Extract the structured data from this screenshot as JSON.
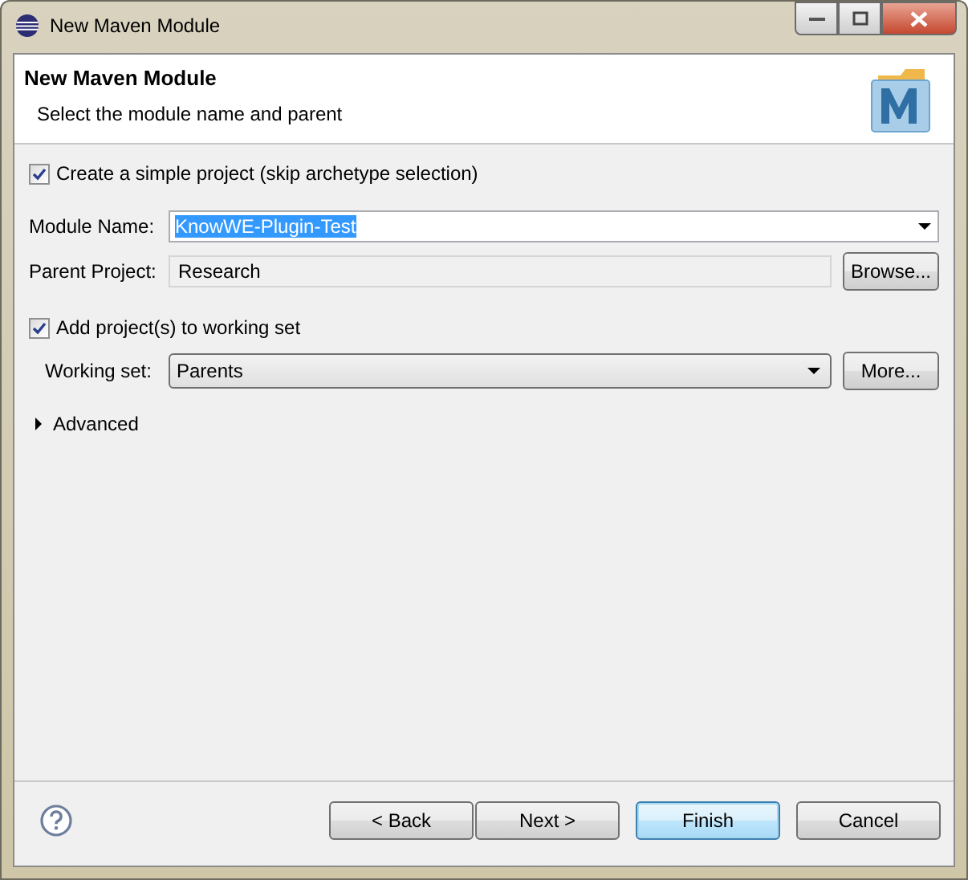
{
  "window": {
    "title": "New Maven Module"
  },
  "header": {
    "title": "New Maven Module",
    "subtitle": "Select the module name and parent"
  },
  "simple_project": {
    "label": "Create a simple project (skip archetype selection)",
    "checked": true
  },
  "module_name": {
    "label": "Module Name:",
    "value": "KnowWE-Plugin-Test",
    "text_selected": true
  },
  "parent_project": {
    "label": "Parent Project:",
    "value": "Research",
    "button": "Browse..."
  },
  "working_set_option": {
    "label": "Add project(s) to working set",
    "checked": true
  },
  "working_set": {
    "label": "Working set:",
    "value": "Parents",
    "button": "More..."
  },
  "advanced": {
    "label": "Advanced",
    "expanded": false
  },
  "buttons": [
    {
      "label": "< Back",
      "default": false
    },
    {
      "label": "Next >",
      "default": false
    },
    {
      "label": "Finish",
      "default": true
    },
    {
      "label": "Cancel",
      "default": false
    }
  ]
}
